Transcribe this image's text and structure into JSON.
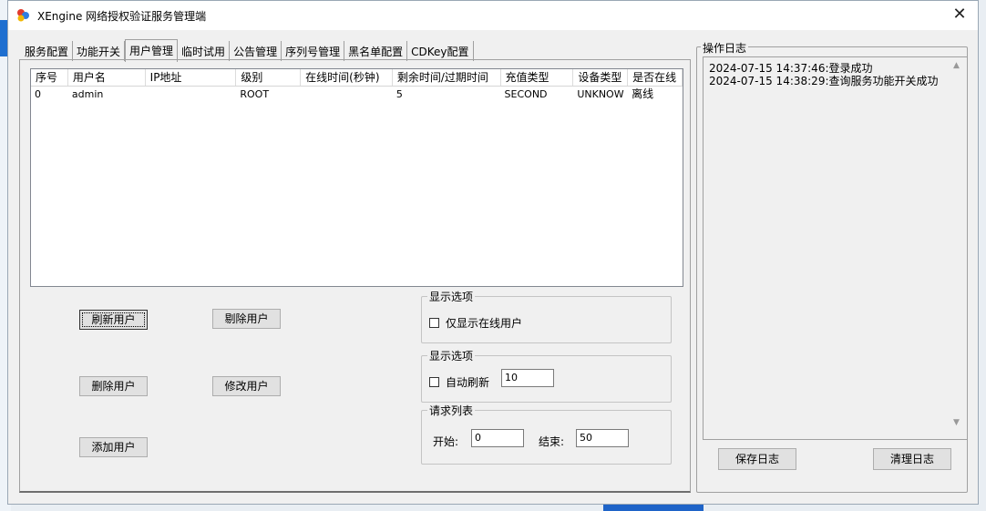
{
  "window": {
    "title": "XEngine 网络授权验证服务管理端",
    "close_glyph": "✕"
  },
  "tabs": [
    {
      "label": "服务配置",
      "active": false
    },
    {
      "label": "功能开关",
      "active": false
    },
    {
      "label": "用户管理",
      "active": true
    },
    {
      "label": "临时试用",
      "active": false
    },
    {
      "label": "公告管理",
      "active": false
    },
    {
      "label": "序列号管理",
      "active": false
    },
    {
      "label": "黑名单配置",
      "active": false
    },
    {
      "label": "CDKey配置",
      "active": false
    }
  ],
  "user_table": {
    "columns": [
      "序号",
      "用户名",
      "IP地址",
      "级别",
      "在线时间(秒钟)",
      "剩余时间/过期时间",
      "充值类型",
      "设备类型",
      "是否在线"
    ],
    "rows": [
      [
        "0",
        "admin",
        "",
        "ROOT",
        "",
        "5",
        "SECOND",
        "UNKNOW",
        "离线"
      ]
    ]
  },
  "buttons": {
    "refresh": "刷新用户",
    "kick": "剔除用户",
    "delete": "删除用户",
    "modify": "修改用户",
    "add": "添加用户"
  },
  "display_options_1": {
    "legend": "显示选项",
    "online_only_label": "仅显示在线用户",
    "online_only_checked": false
  },
  "display_options_2": {
    "legend": "显示选项",
    "auto_refresh_label": "自动刷新",
    "auto_refresh_checked": false,
    "auto_refresh_value": "10"
  },
  "request_list": {
    "legend": "请求列表",
    "start_label": "开始:",
    "start_value": "0",
    "end_label": "结束:",
    "end_value": "50"
  },
  "log": {
    "legend": "操作日志",
    "lines": [
      "2024-07-15 14:37:46:登录成功",
      "2024-07-15 14:38:29:查询服务功能开关成功"
    ],
    "save_label": "保存日志",
    "clear_label": "清理日志"
  },
  "colors": {
    "window_bg": "#f0f0f0",
    "title_bg": "#ffffff",
    "list_bg": "#ffffff"
  }
}
